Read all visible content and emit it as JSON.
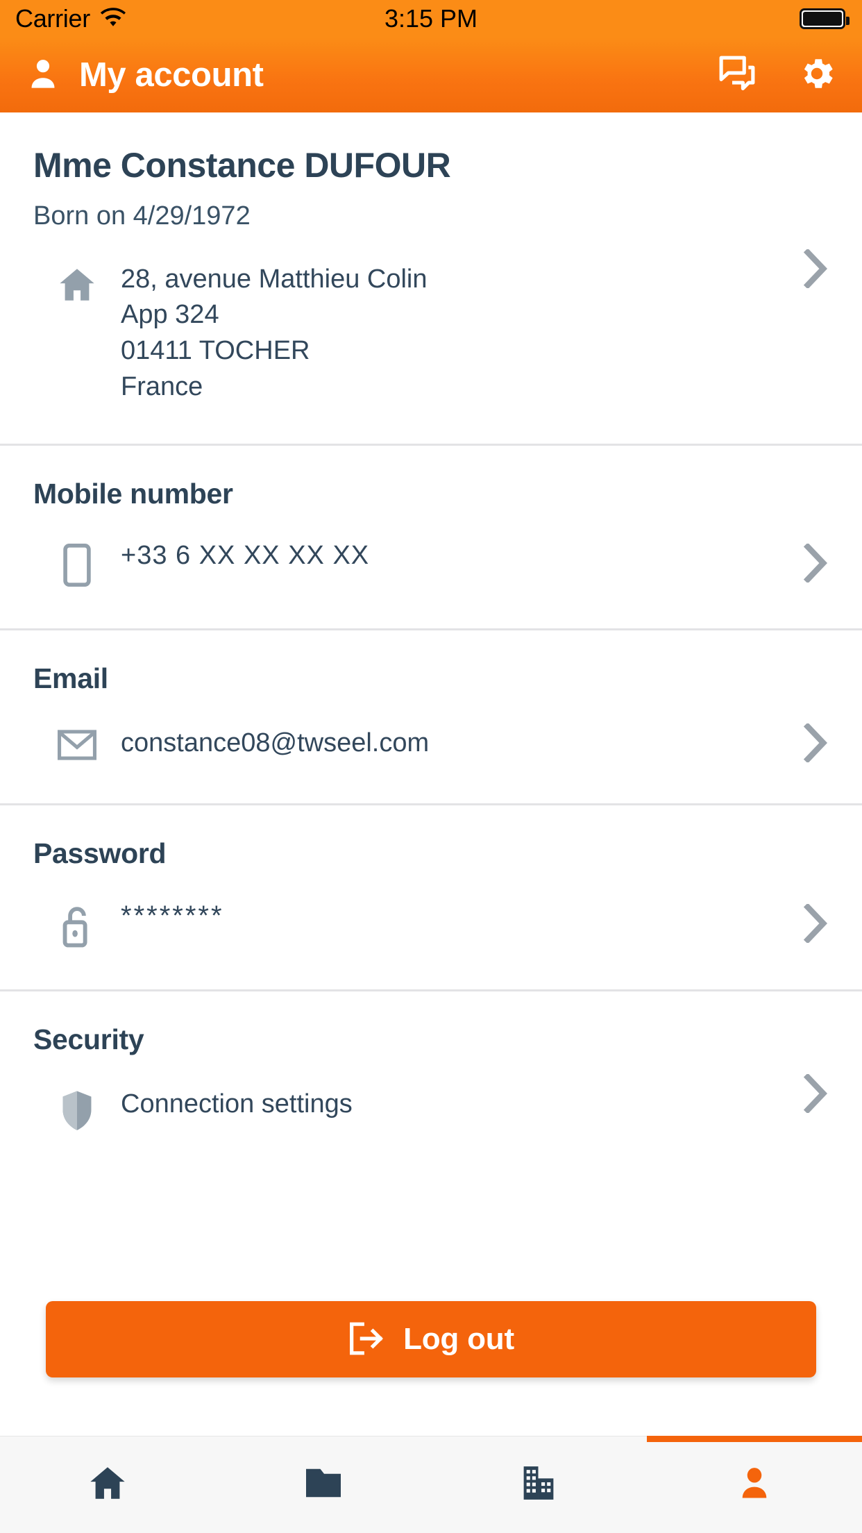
{
  "status_bar": {
    "carrier": "Carrier",
    "wifi_icon": "wifi-icon",
    "time": "3:15 PM",
    "battery_icon": "battery-full-icon"
  },
  "header": {
    "account_icon": "person-icon",
    "title": "My account",
    "messages_icon": "forum-icon",
    "settings_icon": "gear-icon",
    "background_color": "#f97311"
  },
  "identity": {
    "name": "Mme Constance DUFOUR",
    "birth_line": "Born on 4/29/1972"
  },
  "address": {
    "icon": "home-icon",
    "lines": [
      "28, avenue Matthieu Colin",
      "App 324",
      "01411 TOCHER",
      "France"
    ],
    "chevron": "chevron-right-icon"
  },
  "sections": [
    {
      "title": "Mobile number",
      "icon": "smartphone-icon",
      "value": "+33 6 XX XX XX XX",
      "chevron": "chevron-right-icon"
    },
    {
      "title": "Email",
      "icon": "envelope-icon",
      "value": "constance08@twseel.com",
      "chevron": "chevron-right-icon"
    },
    {
      "title": "Password",
      "icon": "padlock-open-icon",
      "value": "********",
      "chevron": "chevron-right-icon"
    },
    {
      "title": "Security",
      "icon": "shield-icon",
      "value": "Connection settings",
      "chevron": "chevron-right-icon"
    }
  ],
  "logout": {
    "icon": "logout-icon",
    "label": "Log out",
    "color": "#f4640c"
  },
  "tabbar": {
    "active_index": 3,
    "active_color": "#f4640c",
    "inactive_color": "#2d4356",
    "items": [
      {
        "icon": "home-icon",
        "name": "tab-home"
      },
      {
        "icon": "folder-icon",
        "name": "tab-folder"
      },
      {
        "icon": "building-icon",
        "name": "tab-company"
      },
      {
        "icon": "person-icon",
        "name": "tab-account"
      }
    ]
  },
  "colors": {
    "text_dark": "#2d4356",
    "text_body": "#32475b",
    "icon_gray": "#93a0ab",
    "divider": "#e3e3e5"
  }
}
